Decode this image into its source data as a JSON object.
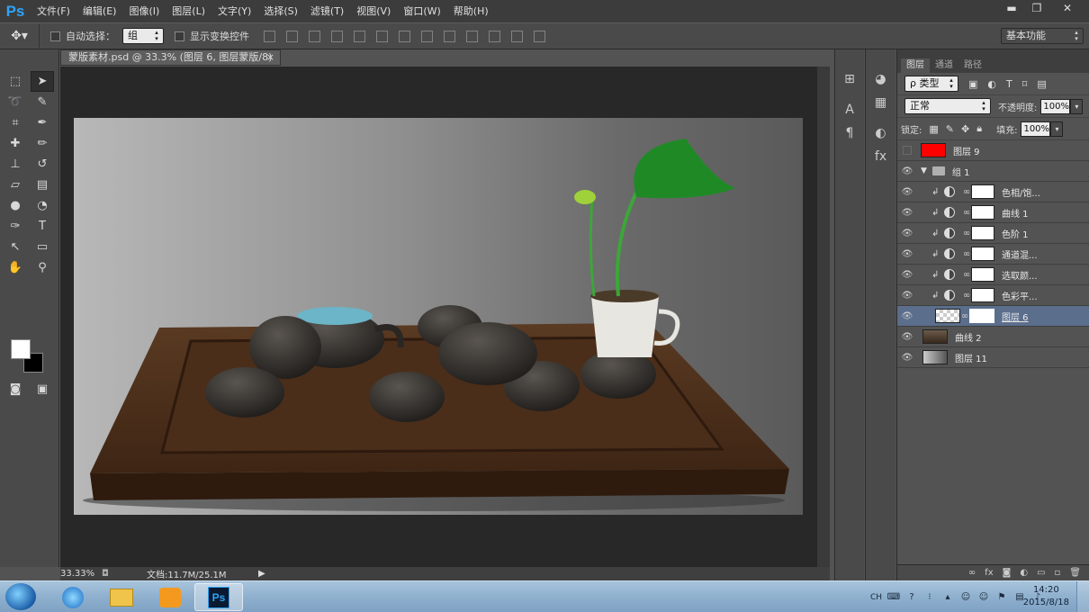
{
  "app": {
    "logo": "Ps"
  },
  "menu": [
    "文件(F)",
    "编辑(E)",
    "图像(I)",
    "图层(L)",
    "文字(Y)",
    "选择(S)",
    "滤镜(T)",
    "视图(V)",
    "窗口(W)",
    "帮助(H)"
  ],
  "window_controls": {
    "minimize": "▬",
    "restore": "❐",
    "close": "✕"
  },
  "options": {
    "auto_select_label": "自动选择：",
    "auto_select_value": "组",
    "show_transform_label": "显示变换控件",
    "workspace": "基本功能"
  },
  "document": {
    "tab_title": "蒙版素材.psd @ 33.3% (图层 6, 图层蒙版/8) *",
    "tab_close": "×",
    "zoom": "33.33%",
    "doc_size": "文档:11.7M/25.1M"
  },
  "layers_panel": {
    "tabs": [
      "图层",
      "通道",
      "路径"
    ],
    "kind_label": "ρ 类型",
    "blend_mode": "正常",
    "opacity_label": "不透明度:",
    "opacity": "100%",
    "lock_label": "锁定:",
    "fill_label": "填充:",
    "fill": "100%",
    "layers": [
      {
        "name": "图层 9",
        "type": "pixel",
        "thumb": "red",
        "visible": false
      },
      {
        "name": "组 1",
        "type": "group",
        "visible": true
      },
      {
        "name": "色相/饱...",
        "type": "adjustment",
        "visible": true
      },
      {
        "name": "曲线 1",
        "type": "adjustment",
        "visible": true
      },
      {
        "name": "色阶 1",
        "type": "adjustment",
        "visible": true
      },
      {
        "name": "通道混...",
        "type": "adjustment",
        "visible": true
      },
      {
        "name": "选取颜...",
        "type": "adjustment",
        "visible": true
      },
      {
        "name": "色彩平...",
        "type": "adjustment",
        "visible": true
      },
      {
        "name": "图层 6",
        "type": "masked",
        "visible": true,
        "selected": true
      },
      {
        "name": "曲线 2",
        "type": "curves",
        "visible": true
      },
      {
        "name": "图层 11",
        "type": "gradient",
        "visible": true
      }
    ]
  },
  "taskbar": {
    "lang": "CH",
    "time": "14:20",
    "date": "2015/8/18"
  },
  "colors": {
    "accent": "#2fa3f7",
    "selected_layer": "#5b6e8c",
    "panel_bg": "#535353"
  }
}
